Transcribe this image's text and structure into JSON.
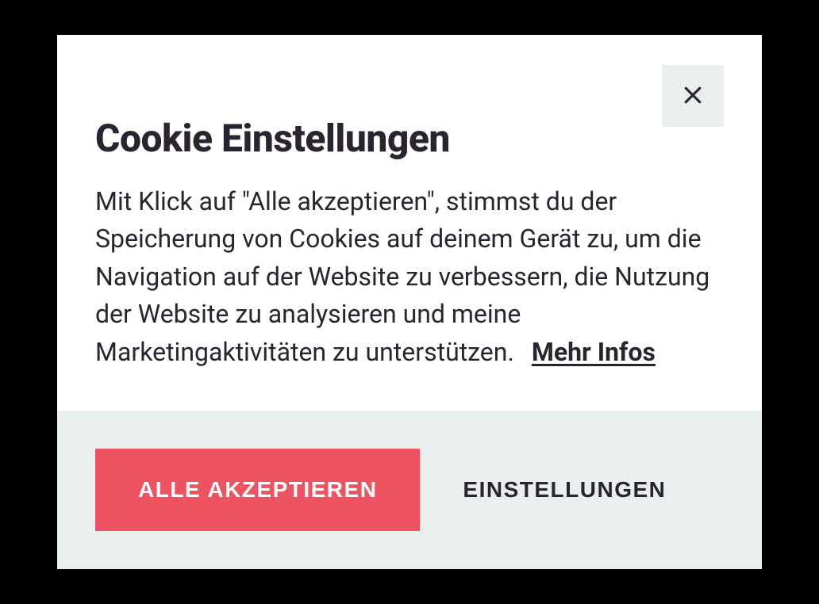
{
  "modal": {
    "title": "Cookie Einstellungen",
    "description": "Mit Klick auf \"Alle akzeptieren\", stimmst du der Speicherung von Cookies auf deinem Gerät zu, um die Navigation auf der Website zu verbessern, die Nutzung der Website zu analysieren und meine Marketingaktivitäten zu unterstützen.",
    "more_info_label": "Mehr Infos",
    "accept_all_label": "ALLE AKZEPTIEREN",
    "settings_label": "EINSTELLUNGEN"
  },
  "colors": {
    "primary": "#ef5261",
    "text": "#2a2430",
    "footer_bg": "#e9efef"
  }
}
